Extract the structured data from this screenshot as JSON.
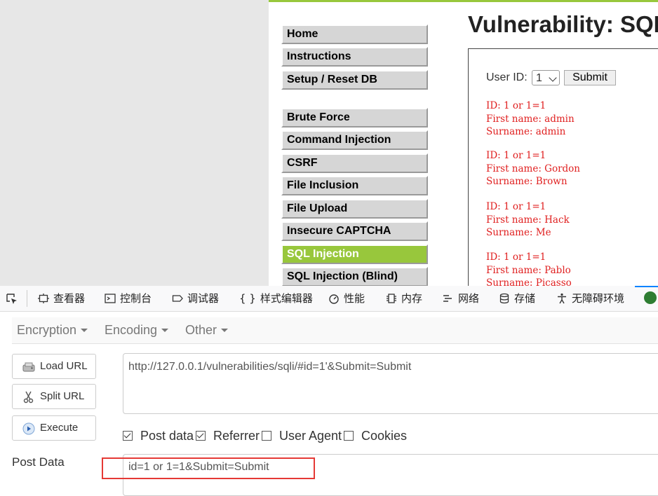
{
  "web_page": {
    "title": "Vulnerability: SQL",
    "menu": [
      {
        "label": "Home",
        "active": false
      },
      {
        "label": "Instructions",
        "active": false
      },
      {
        "label": "Setup / Reset DB",
        "active": false
      },
      {
        "label": "Brute Force",
        "active": false
      },
      {
        "label": "Command Injection",
        "active": false
      },
      {
        "label": "CSRF",
        "active": false
      },
      {
        "label": "File Inclusion",
        "active": false
      },
      {
        "label": "File Upload",
        "active": false
      },
      {
        "label": "Insecure CAPTCHA",
        "active": false
      },
      {
        "label": "SQL Injection",
        "active": true
      },
      {
        "label": "SQL Injection (Blind)",
        "active": false
      }
    ],
    "form": {
      "user_id_label": "User ID:",
      "user_id_value": "1",
      "submit_label": "Submit"
    },
    "results": [
      {
        "id": "ID: 1 or 1=1",
        "first": "First name: admin",
        "surname": "Surname: admin"
      },
      {
        "id": "ID: 1 or 1=1",
        "first": "First name: Gordon",
        "surname": "Surname: Brown"
      },
      {
        "id": "ID: 1 or 1=1",
        "first": "First name: Hack",
        "surname": "Surname: Me"
      },
      {
        "id": "ID: 1 or 1=1",
        "first": "First name: Pablo",
        "surname": "Surname: Picasso"
      }
    ],
    "colors": {
      "accent": "#98c73c",
      "result_text": "#e02020"
    }
  },
  "devtools": {
    "tabs": [
      {
        "label": "查看器",
        "icon": "inspector-icon"
      },
      {
        "label": "控制台",
        "icon": "console-icon"
      },
      {
        "label": "调试器",
        "icon": "debugger-icon"
      },
      {
        "label": "样式编辑器",
        "icon": "style-editor-icon"
      },
      {
        "label": "性能",
        "icon": "performance-icon"
      },
      {
        "label": "内存",
        "icon": "memory-icon"
      },
      {
        "label": "网络",
        "icon": "network-icon"
      },
      {
        "label": "存储",
        "icon": "storage-icon"
      },
      {
        "label": "无障碍环境",
        "icon": "accessibility-icon"
      }
    ]
  },
  "hackbar": {
    "menu": [
      "Encryption",
      "Encoding",
      "Other"
    ],
    "buttons": {
      "load": "Load URL",
      "split": "Split URL",
      "execute": "Execute"
    },
    "url": "http://127.0.0.1/vulnerabilities/sqli/#id=1'&Submit=Submit",
    "options": [
      {
        "label": "Post data",
        "checked": true
      },
      {
        "label": "Referrer",
        "checked": true
      },
      {
        "label": "User Agent",
        "checked": false
      },
      {
        "label": "Cookies",
        "checked": false
      }
    ],
    "post_label": "Post Data",
    "post_value": "id=1 or 1=1&Submit=Submit",
    "highlight_color": "#e53935"
  }
}
